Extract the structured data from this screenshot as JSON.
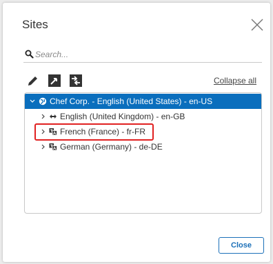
{
  "dialog": {
    "title": "Sites",
    "close_icon": "close-icon"
  },
  "search": {
    "icon": "search-icon",
    "placeholder": "Search...",
    "value": ""
  },
  "toolbar": {
    "edit_icon": "pencil-icon",
    "expand_icon": "expand-icon",
    "swap_icon": "swap-icon",
    "collapse_label": "Collapse all"
  },
  "tree": {
    "root": {
      "label": "Chef Corp. - English (United States) - en-US",
      "expanded": true,
      "selected": true,
      "icon": "globe-icon"
    },
    "children": [
      {
        "label": "English (United Kingdom) - en-GB",
        "icon": "link-arrows-icon",
        "expanded": false
      },
      {
        "label": "French (France) - fr-FR",
        "icon": "translate-icon",
        "expanded": false,
        "highlighted": true
      },
      {
        "label": "German (Germany) - de-DE",
        "icon": "translate-icon",
        "expanded": false
      }
    ]
  },
  "footer": {
    "close_label": "Close"
  },
  "colors": {
    "selection": "#0a6ebd",
    "accent": "#1a6fb8",
    "highlight": "#e02020"
  }
}
